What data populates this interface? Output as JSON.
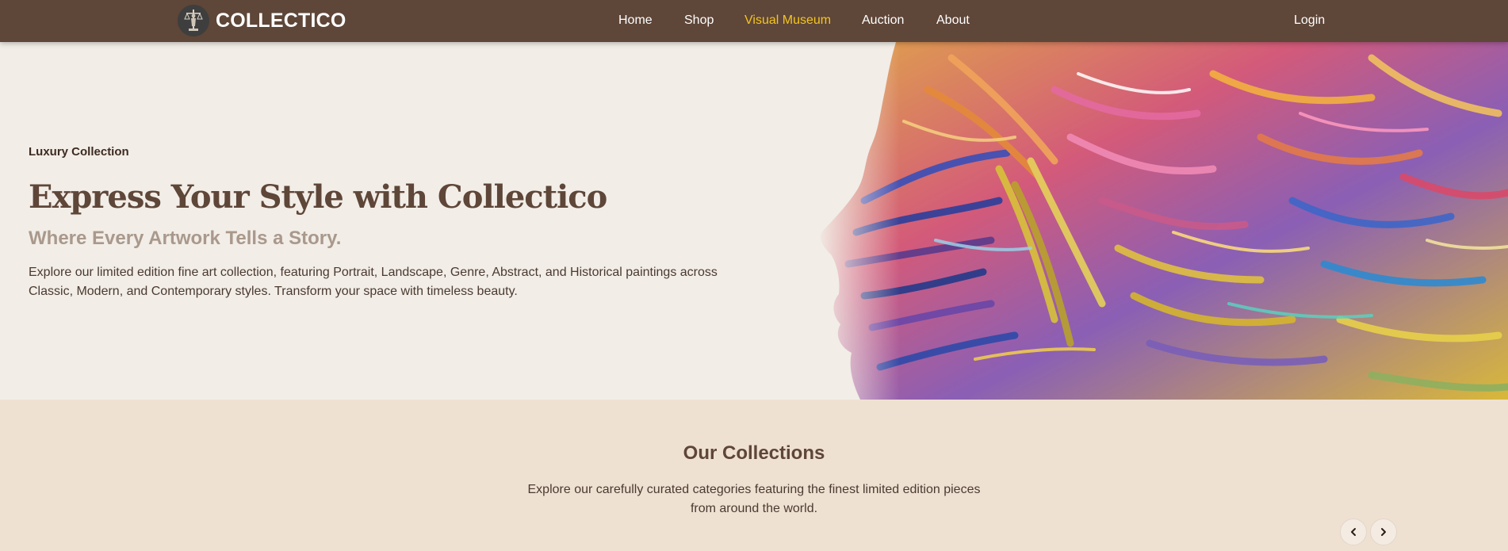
{
  "brand": {
    "name": "COLLECTICO",
    "logo_icon": "scales-statue-icon"
  },
  "nav": {
    "links": [
      {
        "label": "Home",
        "active": false
      },
      {
        "label": "Shop",
        "active": false
      },
      {
        "label": "Visual Museum",
        "active": true
      },
      {
        "label": "Auction",
        "active": false
      },
      {
        "label": "About",
        "active": false
      }
    ],
    "login_label": "Login"
  },
  "hero": {
    "eyebrow": "Luxury Collection",
    "title": "Express Your Style with Collectico",
    "subtitle": "Where Every Artwork Tells a Story.",
    "description": "Explore our limited edition fine art collection, featuring Portrait, Landscape, Genre, Abstract, and Historical paintings across Classic, Modern, and Contemporary styles. Transform your space with timeless beauty.",
    "image": "colorful painted face profile artwork"
  },
  "collections": {
    "title": "Our Collections",
    "description": "Explore our carefully curated categories featuring the finest limited edition pieces from around the world.",
    "prev_icon": "chevron-left-icon",
    "next_icon": "chevron-right-icon"
  },
  "colors": {
    "nav_bg": "#5e4638",
    "active_link": "#f4c51f",
    "hero_bg": "#f2ede7",
    "section_bg": "#efe1d2",
    "heading": "#5e4638"
  }
}
